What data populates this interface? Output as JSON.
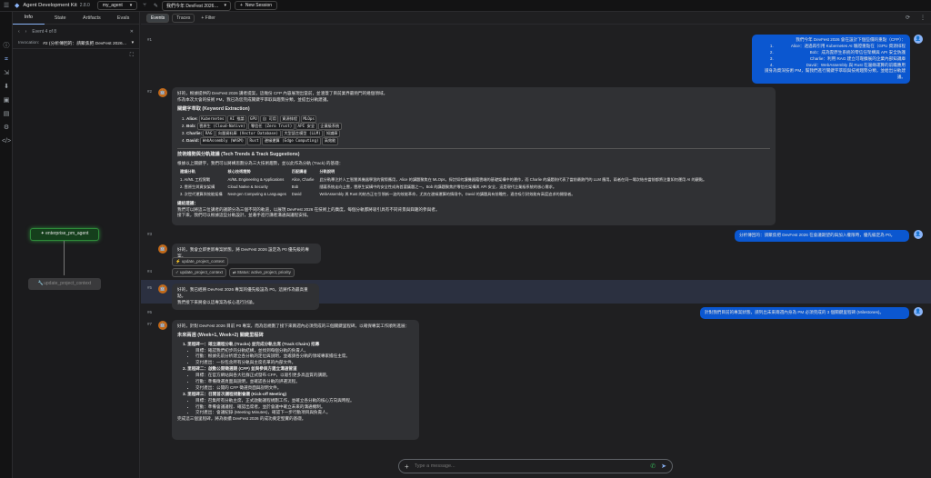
{
  "topbar": {
    "title": "Agent Development Kit",
    "version": "2.8.0",
    "app_select": "my_agent",
    "session_title": "我們今年 DevFest 2026…",
    "new_session": "New Session"
  },
  "sidebar": {
    "tabs": [
      "Info",
      "State",
      "Artifacts",
      "Evals"
    ],
    "event_nav": "Event 4 of 8",
    "invocation_label": "Invocation:",
    "invocation_value": "#2 (分析傳回的：請聚焦把 DevFest 2026…"
  },
  "graph": {
    "node_active": "enterprise_pm_agent",
    "node_inactive": "update_project_context"
  },
  "subbar": {
    "events": "Events",
    "traces": "Traces",
    "filter": "Filter"
  },
  "row_numbers": [
    "#1",
    "#2",
    "#3",
    "#4",
    "#5",
    "#6",
    "#7"
  ],
  "messages": {
    "m1_user": {
      "title": "我們今年 DevFest 2026 會在設計下個些價的重點（CFP）：",
      "items": [
        "Alice：透過再引用 Kubernetes AI 驗證重點在（GPU 資源排程",
        "Bob：成為雲原生系統的零信任架構與 API 安全防護",
        "Charlie：利用 RAG 建立可靠擴展的企業內部知識庫",
        "David：WebAssembly 與 Rust 在邊緣運算的前瞻應用"
      ],
      "footer": "請身為資深技術 PM，幫我們進行關鍵字萃取與技術趨勢分類，並給出分軌建議。"
    },
    "m2_bot": {
      "intro": "好的，根據提供的 DevFest 2026 講者提案，這幾份 CFP 內容展現出當前，並涵蓋了目前業界最熱門的幾個領域。",
      "intro2": "作為本次大會的技術 PM，我已為您完成關鍵字萃取與趨勢分類，並提出分軌建議。",
      "h1": "關鍵字萃取 (Keyword Extraction)",
      "kw": [
        {
          "name": "Alice:",
          "tags": [
            "Kubernetes",
            "AI 推論",
            "GPU",
            "自 可用",
            "資源排程",
            "MLOps"
          ]
        },
        {
          "name": "Bob:",
          "tags": [
            "雲原生 (Cloud-Native)",
            "零信任 (Zero Trust)",
            "API 安全",
            "企業級系統"
          ]
        },
        {
          "name": "Charlie:",
          "tags": [
            "RAG",
            "向量資料庫 (Vector Database)",
            "大型語言模型 (LLM)",
            "知識庫"
          ]
        },
        {
          "name": "David:",
          "tags": [
            "WebAssembly (WASM)",
            "Rust",
            "邊緣運算 (Edge Computing)",
            "高效能"
          ]
        }
      ],
      "h2": "技術趨勢與分軌建議 (Tech Trends & Track Suggestions)",
      "trend_intro": "根據以上關鍵字，我們可以將構思劃分為三大技術趨勢，並以此作為分軌 (Track) 的基礎：",
      "table_head": [
        "建議分軌",
        "核心技術趨勢",
        "匹配講者",
        "分軌說明"
      ],
      "table_rows": [
        [
          "1. AI/ML 工程實戰",
          "AI/ML Engineering & Applications",
          "Alice, Charlie",
          "此分軌專注於人工智慧與機器學習的實際應用，Alice 的講題聚焦在 MLOps，探討如何讓機器藉雲端的基礎架構中的運作，而 Charlie 的議題則代表了當前最熱門的 LLM 應用。兩者在同一場次結合當前都將注重如何運用 AI 的觀點。"
        ],
        [
          "2. 雲原生與資安架構",
          "Cloud Native & Security",
          "Bob",
          "隨著系統走向上雲，雲原生架構中的安全性成為首要議題之一。Bob 的講題聚焦於零信任架構與 API 安全，這是現代企業級系統的核心需求。"
        ],
        [
          "3. 次世代運算與效能架構",
          "Next-gen Computing & Languages",
          "David",
          "WebAssembly 與 Rust 的結合正在引領新一波的效能革命，尤其在邊緣運算的情境中。David 的講題具有前瞻性，適合吸引對效能有高度追求的開發者。"
        ]
      ],
      "note_h": "總結建議：",
      "note": "我們可以將這三位講者的議題分為三個不同的軌道，以展現 DevFest 2026 在技術上的廣度。每個分軌都將吸引具有不同背景與興趣的參與者。",
      "note2": "接下來，我們可以根據這些分軌設計，並著手進行講者溝通與議程安排。"
    },
    "m3_user": "分析傳回的：請聚焦把 DevFest 2026 在會議期望的與加入權限時，優先級定為 P0。",
    "m4_bot": "好的，我會立即更新專案狀態，將 DevFest 2026 設定為 P0 優先級的專案。",
    "m4_call": "update_project_context",
    "m5_call_a": "update_project_context",
    "m5_call_b": "Status: active_project, priority",
    "m6_bot": "好的，我已經將 DevFest 2026 專案的優先級設為 P0。這將作為最高重點。",
    "m6_bot2": "我們接下來將會以這專案為核心進行討論。",
    "m7_user": "針對我們目前的專案狀態，請列出未來兩週內身為 PM 必須完成的 3 個關鍵里程碑 (Milestones)。",
    "m8_bot": {
      "intro": "好的，針對 DevFest 2026 目前 P0 專案，而為您規劃了接下來兩週內必須完成的三個關鍵里程碑，以確保專案工作順利進展：",
      "h": "未來兩週 (Week+1, Week+2) 關鍵里程碑",
      "ms": [
        {
          "title": "1. 里程碑一：確立議程分軌 (Tracks) 並完成分軌主席 (Track Chairs) 招募",
          "items": [
            "目標：確認我們初步的分軌結構，並找到每個分軌的負責人。",
            "行動：根據先前分析建立各分軌的定位與說明，並邀請各分軌的領域專家擔任主席。",
            "交付產出：一份包含所有分軌與主席名單的內部文件。"
          ]
        },
        {
          "title": "2. 里程碑二：啟動公開徵選期 (CFP) 並與參與方建立溝通管道",
          "items": [
            "目標：在官方網站與各大社群正式發布 CFP，以吸引更多高品質的講題。",
            "行動：準備徵選頁面與說明，並確認各分軌的評選流程。",
            "交付產出：公開的 CFP 徵選頁面與說明文件。"
          ]
        },
        {
          "title": "3. 里程碑三：召開首次議程規劃會議 (Kick-off Meeting)",
          "items": [
            "目標：召集所有分軌主席，正式啟動議程規劃工作，並確立各分軌的核心方向與時程。",
            "行動：準備會議議程、確認出席者，並於會議中確立未來的溝通機制。",
            "交付產出：會議紀錄 (Meeting Minutes)，確認下一步行動項目與負責人。"
          ]
        }
      ],
      "outro": "完成這三個里程碑，將為後續 DevFest 2026 的成功奠定堅實的基礎。"
    }
  },
  "input": {
    "placeholder": "Type a message..."
  }
}
